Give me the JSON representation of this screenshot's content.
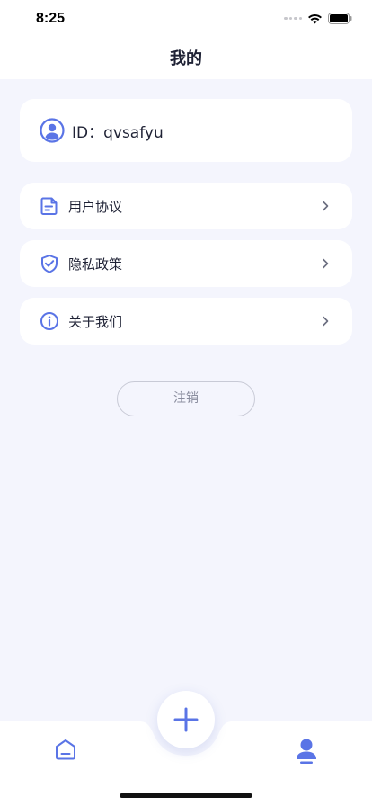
{
  "status_bar": {
    "time": "8:25"
  },
  "nav": {
    "title": "我的"
  },
  "profile": {
    "id_text": "ID：qvsafyu"
  },
  "menu": {
    "items": [
      {
        "label": "用户协议",
        "icon": "document-icon"
      },
      {
        "label": "隐私政策",
        "icon": "shield-check-icon"
      },
      {
        "label": "关于我们",
        "icon": "info-icon"
      }
    ]
  },
  "logout": {
    "label": "注销"
  },
  "tab_bar": {
    "tabs": [
      {
        "name": "home",
        "icon": "home-icon",
        "active": false
      },
      {
        "name": "add",
        "icon": "plus-icon"
      },
      {
        "name": "mine",
        "icon": "user-icon",
        "active": true
      }
    ]
  },
  "colors": {
    "accent": "#5a74e6",
    "background": "#f4f5fd",
    "card": "#ffffff",
    "text": "#1f2235",
    "muted": "#8a8d9e"
  }
}
